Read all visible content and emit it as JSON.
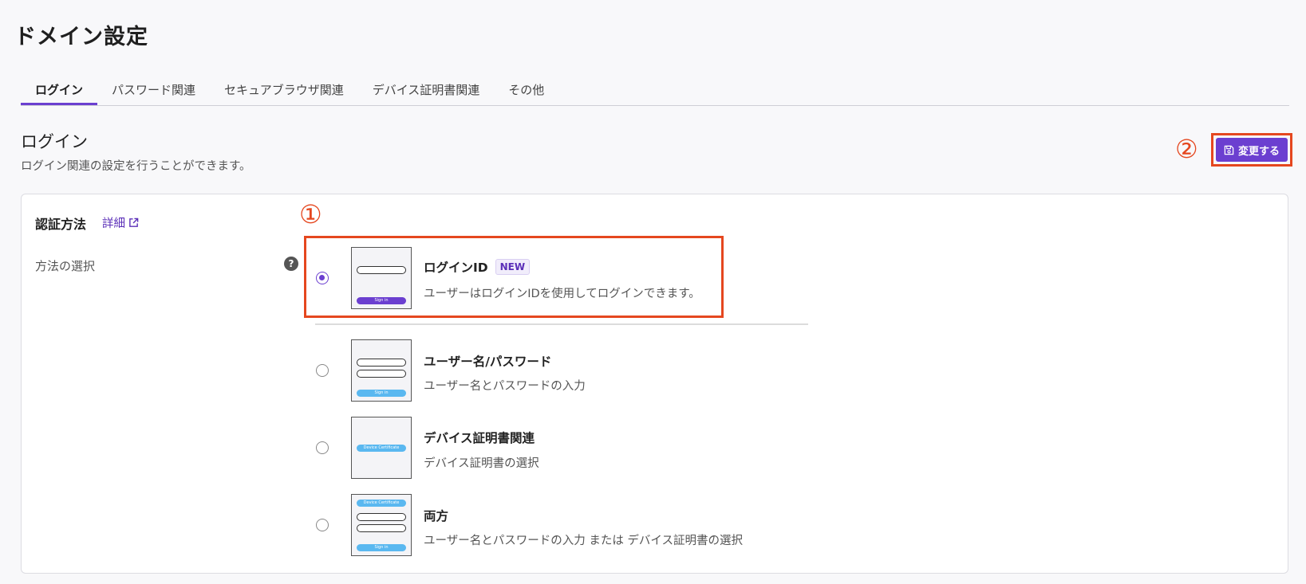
{
  "page": {
    "title": "ドメイン設定"
  },
  "tabs": [
    {
      "label": "ログイン",
      "active": true
    },
    {
      "label": "パスワード関連",
      "active": false
    },
    {
      "label": "セキュアブラウザ関連",
      "active": false
    },
    {
      "label": "デバイス証明書関連",
      "active": false
    },
    {
      "label": "その他",
      "active": false
    }
  ],
  "section": {
    "title": "ログイン",
    "description": "ログイン関連の設定を行うことができます。"
  },
  "save_button": {
    "label": "変更する",
    "icon": "save-icon"
  },
  "annotations": {
    "one": "①",
    "two": "②",
    "color": "#e5471f"
  },
  "auth": {
    "title": "認証方法",
    "detail_link": "詳細",
    "method_label": "方法の選択",
    "help_icon": "?",
    "options": [
      {
        "title": "ログインID",
        "badge": "NEW",
        "description": "ユーザーはログインIDを使用してログインできます。",
        "selected": true,
        "thumb_pill": "Sign in"
      },
      {
        "title": "ユーザー名/パスワード",
        "description": "ユーザー名とパスワードの入力",
        "selected": false,
        "thumb_pill": "Sign in"
      },
      {
        "title": "デバイス証明書関連",
        "description": "デバイス証明書の選択",
        "selected": false,
        "thumb_pill": "Device Certificate"
      },
      {
        "title": "両方",
        "description": "ユーザー名とパスワードの入力 または デバイス証明書の選択",
        "selected": false,
        "thumb_pill_top": "Device Certificate",
        "thumb_pill": "Sign in"
      }
    ]
  },
  "colors": {
    "accent": "#6b3fd0",
    "thumb_blue": "#5ab8f0"
  }
}
